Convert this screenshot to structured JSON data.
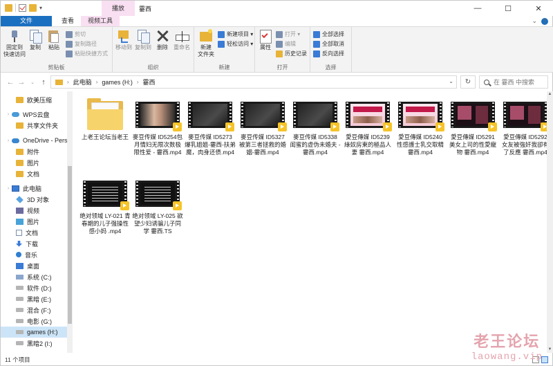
{
  "window": {
    "title": "霎西",
    "context_tab": "播放",
    "controls": [
      "—",
      "☐",
      "✕"
    ]
  },
  "ribbon_tabs": [
    {
      "label": "文件",
      "kind": "file"
    },
    {
      "label": "主页",
      "kind": "active"
    },
    {
      "label": "共享",
      "kind": "normal"
    },
    {
      "label": "查看",
      "kind": "normal"
    },
    {
      "label": "视频工具",
      "kind": "ctx"
    }
  ],
  "ribbon": {
    "clipboard": {
      "label": "剪贴板",
      "pin": "固定到\n快速访问",
      "copy": "复制",
      "paste": "粘贴",
      "cut": "剪切",
      "copy_path": "复制路径",
      "paste_shortcut": "粘贴快捷方式"
    },
    "organize": {
      "label": "组织",
      "move_to": "移动到",
      "copy_to": "复制到",
      "delete": "删除",
      "rename": "重命名"
    },
    "new": {
      "label": "新建",
      "new_folder": "新建\n文件夹",
      "new_item": "新建项目 ▾",
      "easy_access": "轻松访问 ▾"
    },
    "open": {
      "label": "打开",
      "properties": "属性",
      "open": "打开 ▾",
      "edit": "编辑",
      "history": "历史记录"
    },
    "select": {
      "label": "选择",
      "select_all": "全部选择",
      "select_none": "全部取消",
      "invert": "反向选择"
    }
  },
  "address": {
    "crumbs": [
      "此电脑",
      "games (H:)",
      "霎西"
    ],
    "search_placeholder": "在 霎西 中搜索"
  },
  "nav": [
    {
      "label": "欧美压缩",
      "icon": "fold",
      "indent": 1
    },
    {
      "label": "WPS云盘",
      "icon": "wps",
      "indent": 0
    },
    {
      "label": "共享文件夹",
      "icon": "fold",
      "indent": 1
    },
    {
      "label": "OneDrive - Perso",
      "icon": "cloud",
      "indent": 0
    },
    {
      "label": "附件",
      "icon": "fold",
      "indent": 1
    },
    {
      "label": "图片",
      "icon": "fold",
      "indent": 1
    },
    {
      "label": "文档",
      "icon": "fold",
      "indent": 1
    },
    {
      "label": "此电脑",
      "icon": "pc",
      "indent": 0
    },
    {
      "label": "3D 对象",
      "icon": "cube",
      "indent": 1
    },
    {
      "label": "视频",
      "icon": "vid",
      "indent": 1
    },
    {
      "label": "图片",
      "icon": "pic",
      "indent": 1
    },
    {
      "label": "文档",
      "icon": "doc",
      "indent": 1
    },
    {
      "label": "下载",
      "icon": "down",
      "indent": 1
    },
    {
      "label": "音乐",
      "icon": "music",
      "indent": 1
    },
    {
      "label": "桌面",
      "icon": "desk",
      "indent": 1
    },
    {
      "label": "系统 (C:)",
      "icon": "sysdrive",
      "indent": 1
    },
    {
      "label": "软件 (D:)",
      "icon": "drive",
      "indent": 1
    },
    {
      "label": "黑暗 (E:)",
      "icon": "drive",
      "indent": 1
    },
    {
      "label": "混合 (F:)",
      "icon": "drive",
      "indent": 1
    },
    {
      "label": "电影 (G:)",
      "icon": "drive",
      "indent": 1
    },
    {
      "label": "games (H:)",
      "icon": "drive",
      "indent": 1,
      "selected": true
    },
    {
      "label": "黑暗2 (I:)",
      "icon": "drive",
      "indent": 1
    }
  ],
  "files": [
    {
      "name": "上老王论坛当老王",
      "type": "folder"
    },
    {
      "name": "麥豆传媒 ID5254包月情妇无限次数极限性爱 - 霎西.mp4",
      "type": "video",
      "thumb": "skin"
    },
    {
      "name": "麥豆传媒 ID5273 爆乳姐姐-霎西-扶弟魔，肉身还债.mp4",
      "type": "video",
      "thumb": "dark"
    },
    {
      "name": "麥豆传媒 ID5327 被第三者拯救的婚姻-霎西.mp4",
      "type": "video",
      "thumb": "dark"
    },
    {
      "name": "麥豆传媒 ID5338 闺蜜的虚伪未婚夫 -霎西.mp4",
      "type": "video",
      "thumb": "dark"
    },
    {
      "name": "愛豆傳媒 ID5239 綠奴房東的極品人妻 霎西.mp4",
      "type": "video",
      "thumb": "pink"
    },
    {
      "name": "愛豆傳媒 ID5240 性感護士乳交取精 霎西.mp4",
      "type": "video",
      "thumb": "pink"
    },
    {
      "name": "愛豆傳媒 ID5291 美女上司的性愛寵物 霎西.mp4",
      "type": "video",
      "thumb": "red"
    },
    {
      "name": "愛豆傳媒 ID5292 女友被強奸我卻有了反應 霎西.mp4",
      "type": "video",
      "thumb": "red"
    },
    {
      "name": "绝对领域 LY-021 青春期的儿子强操性感小妈 .mp4",
      "type": "video",
      "thumb": "text"
    },
    {
      "name": "绝对领域 LY-025 欲望少妇诱骗儿子同学 霎西.TS",
      "type": "video",
      "thumb": "text"
    }
  ],
  "status": {
    "count": "11 个项目"
  },
  "watermark": {
    "line1": "老王论坛",
    "line2": "laowang.vip"
  },
  "colors": {
    "accent": "#1a6fc0",
    "context_tab": "#f9dff2",
    "selection": "#cce4f7",
    "folder": "#e8b339"
  }
}
